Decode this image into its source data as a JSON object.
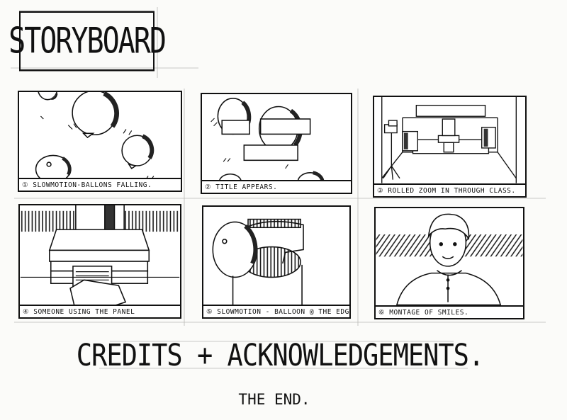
{
  "title": "STORYBOARD",
  "panels": [
    {
      "caption": "① SLOWMOTION-BALLONS FALLING."
    },
    {
      "caption": "② TITLE APPEARS."
    },
    {
      "caption": "③ ROLLED ZOOM IN THROUGH CLASS."
    },
    {
      "caption": "④ SOMEONE USING THE PANEL"
    },
    {
      "caption": "⑤ SLOWMOTION - BALLOON @ THE EDGE"
    },
    {
      "caption": "⑥ MONTAGE OF SMILES."
    }
  ],
  "credits": "CREDITS + ACKNOWLEDGEMENTS.",
  "the_end": "THE END."
}
